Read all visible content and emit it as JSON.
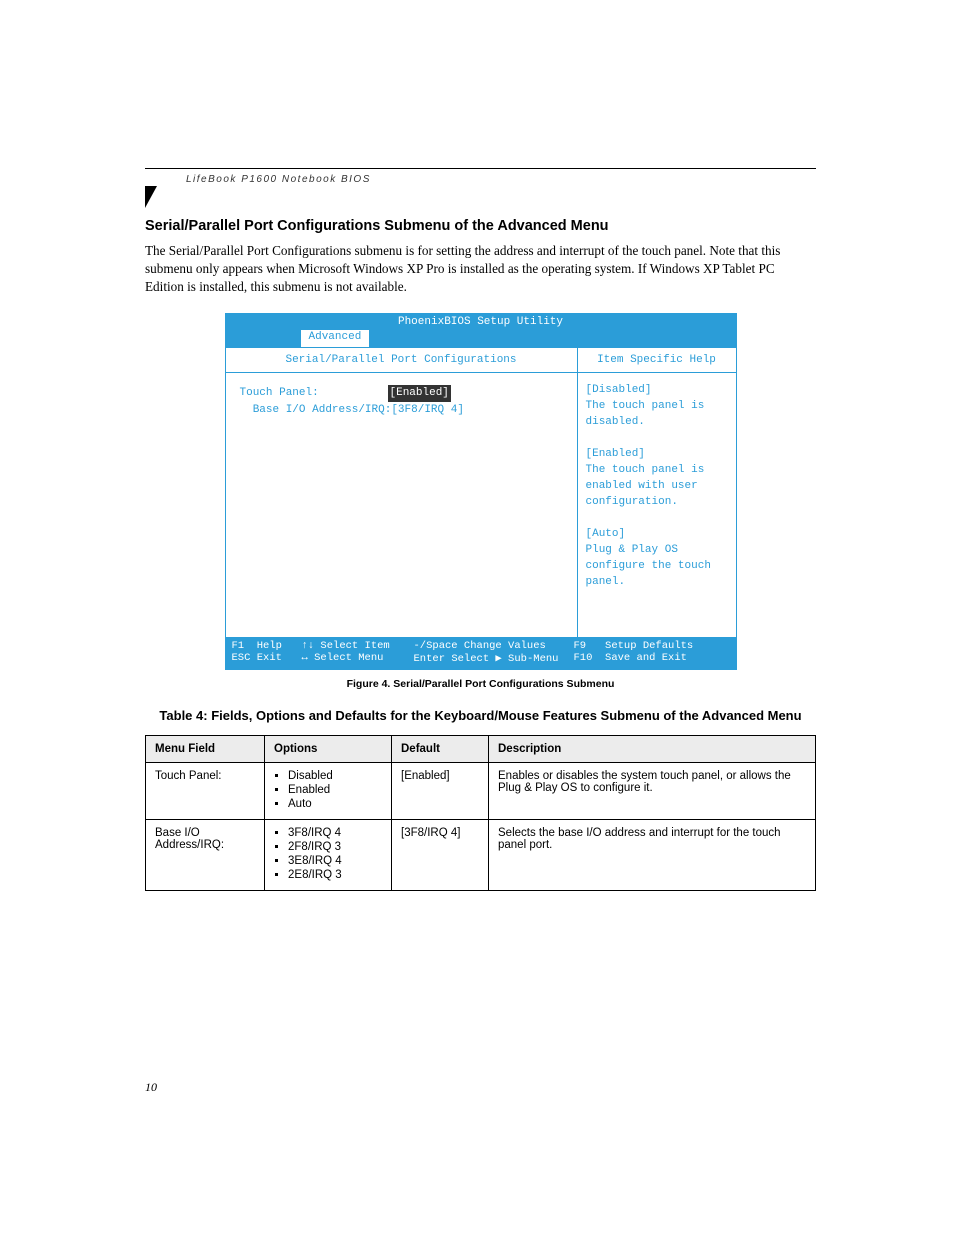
{
  "header_label": "LifeBook P1600 Notebook BIOS",
  "section_title": "Serial/Parallel Port Configurations Submenu of the Advanced Menu",
  "intro_paragraph": "The Serial/Parallel Port Configurations submenu is for setting the address and interrupt of the touch panel.  Note that this submenu only appears when Microsoft Windows XP Pro is installed as the operating system. If Windows XP Tablet PC Edition is installed, this submenu is not available.",
  "bios": {
    "title": "PhoenixBIOS Setup Utility",
    "active_tab": "Advanced",
    "left_heading": "Serial/Parallel Port Configurations",
    "right_heading": "Item Specific Help",
    "rows": [
      {
        "label": "Touch Panel:",
        "value": "[Enabled]",
        "selected": true
      },
      {
        "label": "  Base I/O Address/IRQ:",
        "value": "[3F8/IRQ 4]",
        "selected": false
      }
    ],
    "help_text": "[Disabled]\nThe touch panel is disabled.\n\n[Enabled]\nThe touch panel is enabled with user configuration.\n\n[Auto]\nPlug & Play OS configure the touch panel.",
    "footer": {
      "row1": {
        "c1k": "F1",
        "c1t": "Help",
        "c2k": "↑↓",
        "c2t": "Select Item",
        "c3k": "-/Space",
        "c3t": "Change Values",
        "c4k": "F9",
        "c4t": "Setup Defaults"
      },
      "row2": {
        "c1k": "ESC",
        "c1t": "Exit",
        "c2k": "↔",
        "c2t": "Select Menu",
        "c3k": "Enter",
        "c3t": "Select ▶ Sub-Menu",
        "c4k": "F10",
        "c4t": "Save and Exit"
      }
    }
  },
  "figure_caption": "Figure 4.  Serial/Parallel Port Configurations Submenu",
  "table_title": "Table 4: Fields, Options and Defaults for the Keyboard/Mouse Features Submenu of the Advanced Menu",
  "table": {
    "headers": [
      "Menu Field",
      "Options",
      "Default",
      "Description"
    ],
    "rows": [
      {
        "field": "Touch Panel:",
        "options": [
          "Disabled",
          "Enabled",
          "Auto"
        ],
        "default": "[Enabled]",
        "description": "Enables or disables the system touch panel, or allows the Plug & Play OS to configure it."
      },
      {
        "field": "Base I/O Address/IRQ:",
        "options": [
          "3F8/IRQ 4",
          "2F8/IRQ 3",
          "3E8/IRQ 4",
          "2E8/IRQ 3"
        ],
        "default": "[3F8/IRQ 4]",
        "description": "Selects the base I/O address and interrupt for the touch panel port."
      }
    ]
  },
  "page_number": "10"
}
